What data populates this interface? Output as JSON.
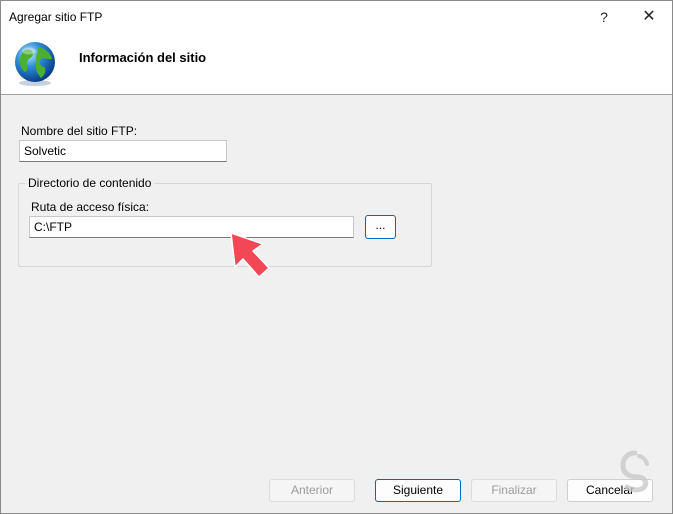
{
  "window": {
    "title": "Agregar sitio FTP",
    "help_label": "?",
    "close_label": "✕"
  },
  "header": {
    "title": "Información del sitio",
    "icon": "globe-icon"
  },
  "site_name": {
    "label": "Nombre del sitio FTP:",
    "value": "Solvetic"
  },
  "content_directory": {
    "legend": "Directorio de contenido",
    "path_label": "Ruta de acceso física:",
    "path_value": "C:\\FTP",
    "browse_label": "..."
  },
  "buttons": {
    "previous": "Anterior",
    "next": "Siguiente",
    "finish": "Finalizar",
    "cancel": "Cancelar"
  },
  "colors": {
    "accent": "#0067c0",
    "arrow": "#f24856"
  }
}
